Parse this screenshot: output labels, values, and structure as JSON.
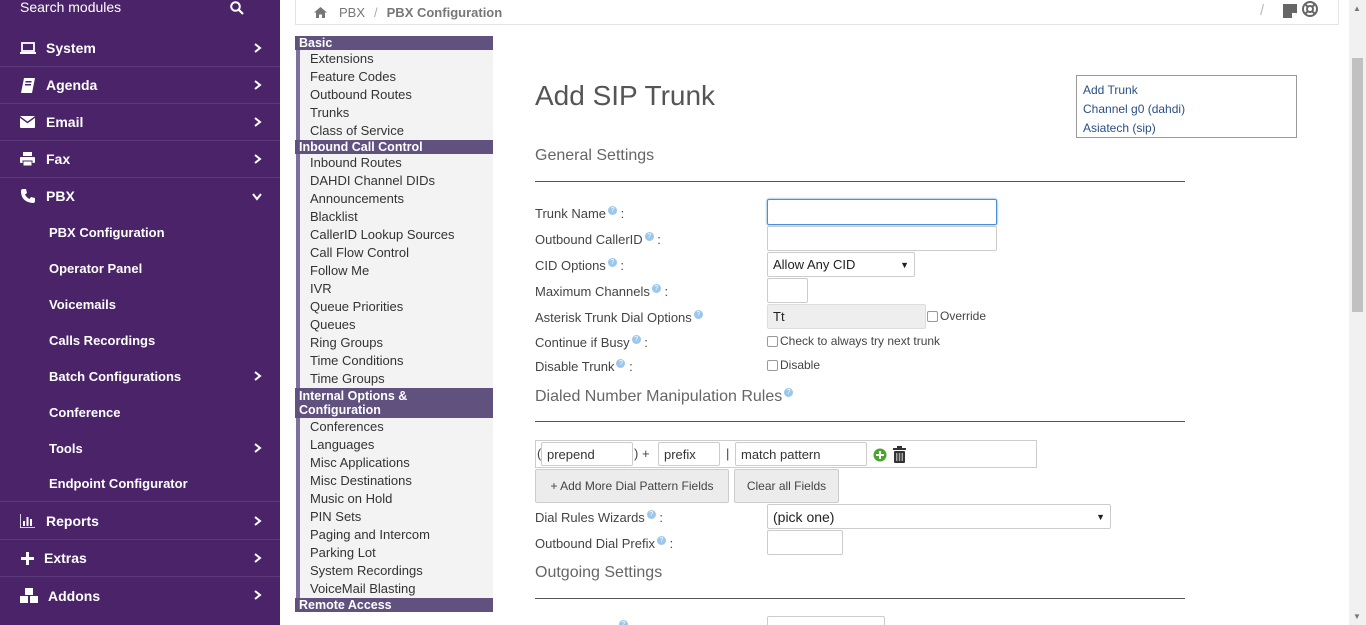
{
  "sidebar": {
    "search_label": "Search modules",
    "items": [
      {
        "label": "System",
        "icon": "laptop-icon"
      },
      {
        "label": "Agenda",
        "icon": "book-icon"
      },
      {
        "label": "Email",
        "icon": "envelope-icon"
      },
      {
        "label": "Fax",
        "icon": "printer-icon"
      },
      {
        "label": "PBX",
        "icon": "phone-icon"
      },
      {
        "label": "Reports",
        "icon": "bar-chart-icon"
      },
      {
        "label": "Extras",
        "icon": "plus-icon"
      },
      {
        "label": "Addons",
        "icon": "cubes-icon"
      }
    ],
    "pbx_sub": [
      "PBX Configuration",
      "Operator Panel",
      "Voicemails",
      "Calls Recordings",
      "Batch Configurations",
      "Conference",
      "Tools",
      "Endpoint Configurator"
    ]
  },
  "breadcrumb": {
    "root": "PBX",
    "current": "PBX Configuration"
  },
  "modules": {
    "basic_header": "Basic",
    "basic": [
      "Extensions",
      "Feature Codes",
      "Outbound Routes",
      "Trunks",
      "Class of Service"
    ],
    "inbound_header": "Inbound Call Control",
    "inbound": [
      "Inbound Routes",
      "DAHDI Channel DIDs",
      "Announcements",
      "Blacklist",
      "CallerID Lookup Sources",
      "Call Flow Control",
      "Follow Me",
      "IVR",
      "Queue Priorities",
      "Queues",
      "Ring Groups",
      "Time Conditions",
      "Time Groups"
    ],
    "internal_header_1": "Internal Options &",
    "internal_header_2": "Configuration",
    "internal": [
      "Conferences",
      "Languages",
      "Misc Applications",
      "Misc Destinations",
      "Music on Hold",
      "PIN Sets",
      "Paging and Intercom",
      "Parking Lot",
      "System Recordings",
      "VoiceMail Blasting"
    ],
    "remote_header": "Remote Access"
  },
  "form": {
    "title": "Add SIP Trunk",
    "general_settings": "General Settings",
    "trunk_name_label": "Trunk Name",
    "outbound_cid_label": "Outbound CallerID",
    "cid_options_label": "CID Options",
    "cid_options_value": "Allow Any CID",
    "max_channels_label": "Maximum Channels",
    "dial_options_label": "Asterisk Trunk Dial Options",
    "dial_options_value": "Tt",
    "override_label": "Override",
    "continue_busy_label": "Continue if Busy",
    "continue_busy_text": "Check to always try next trunk",
    "disable_trunk_label": "Disable Trunk",
    "disable_text": "Disable",
    "dialed_rules_title": "Dialed Number Manipulation Rules",
    "prepend_placeholder": "prepend",
    "prefix_placeholder": "prefix",
    "match_placeholder": "match pattern",
    "add_more_btn": "+ Add More Dial Pattern Fields",
    "clear_btn": "Clear all Fields",
    "dial_wizards_label": "Dial Rules Wizards",
    "dial_wizards_value": "(pick one)",
    "outbound_prefix_label": "Outbound Dial Prefix",
    "outgoing_settings": "Outgoing Settings"
  },
  "trunks_list": [
    "Add Trunk",
    "Channel g0 (dahdi)",
    "Asiatech (sip)"
  ]
}
